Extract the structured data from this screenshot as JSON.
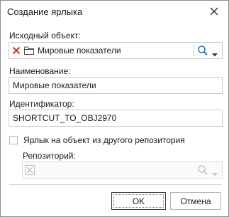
{
  "dialog": {
    "title": "Создание ярлыка",
    "close_icon": "close-icon"
  },
  "source_object": {
    "label": "Исходный объект:",
    "value": "Мировые показатели",
    "icons": [
      "clear-x-icon",
      "folder-icon",
      "search-icon",
      "chevron-down-icon"
    ]
  },
  "name": {
    "label": "Наименование:",
    "value": "Мировые показатели"
  },
  "identifier": {
    "label": "Идентификатор:",
    "value": "SHORTCUT_TO_OBJ2970"
  },
  "other_repo": {
    "checkbox_label": "Ярлык на объект из другого репозитория",
    "checked": false
  },
  "repository": {
    "label": "Репозиторий:",
    "value": "",
    "disabled": true
  },
  "buttons": {
    "ok": "OK",
    "cancel": "Отмена"
  },
  "colors": {
    "clear_x": "#d9342b",
    "search_icon": "#2d73c4"
  }
}
